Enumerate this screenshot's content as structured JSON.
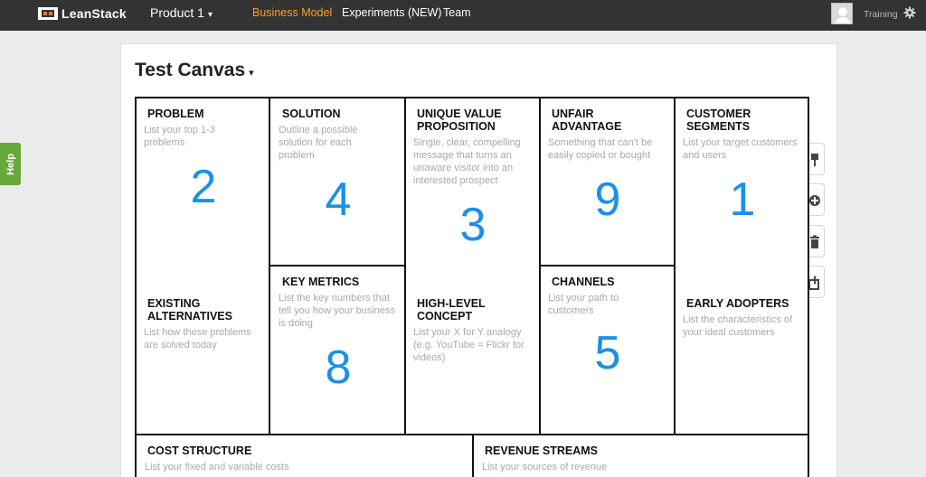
{
  "app": {
    "brand": "LeanStack",
    "product_menu": "Product 1",
    "caret": "▾"
  },
  "nav": {
    "business_model": "Business Model",
    "experiments": "Experiments (NEW)",
    "team": "Team"
  },
  "user": {
    "training": "Training"
  },
  "help": {
    "label": "Help"
  },
  "canvas": {
    "title": "Test Canvas",
    "caret": "▾"
  },
  "colors": {
    "nav_bg": "#333333",
    "active": "#f7a12b",
    "count": "#1991e6",
    "help": "#67a83b"
  },
  "tools": [
    "pin-icon",
    "add-icon",
    "trash-icon",
    "export-icon"
  ],
  "blocks": {
    "problem": {
      "title": "PROBLEM",
      "hint": "List your top 1-3 problems",
      "count": "2"
    },
    "existing_alternatives": {
      "title": "EXISTING ALTERNATIVES",
      "hint": "List how these problems are solved today"
    },
    "solution": {
      "title": "SOLUTION",
      "hint": "Outline a possible solution for each problem",
      "count": "4"
    },
    "key_metrics": {
      "title": "KEY METRICS",
      "hint": "List the key numbers that tell you how your business is doing",
      "count": "8"
    },
    "uvp": {
      "title": "UNIQUE VALUE PROPOSITION",
      "hint": "Single, clear, compelling message that turns an unaware visitor into an interested prospect",
      "count": "3"
    },
    "high_level_concept": {
      "title": "HIGH-LEVEL CONCEPT",
      "hint": "List your X for Y analogy (e.g. YouTube = Flickr for videos)"
    },
    "unfair_advantage": {
      "title": "UNFAIR ADVANTAGE",
      "hint": "Something that can't be easily copied or bought",
      "count": "9"
    },
    "channels": {
      "title": "CHANNELS",
      "hint": "List your path to customers",
      "count": "5"
    },
    "customer_segments": {
      "title": "CUSTOMER SEGMENTS",
      "hint": "List your target customers and users",
      "count": "1"
    },
    "early_adopters": {
      "title": "EARLY ADOPTERS",
      "hint": "List the characteristics of your ideal customers"
    },
    "cost_structure": {
      "title": "COST STRUCTURE",
      "hint": "List your fixed and variable costs"
    },
    "revenue_streams": {
      "title": "REVENUE STREAMS",
      "hint": "List your sources of revenue"
    }
  }
}
